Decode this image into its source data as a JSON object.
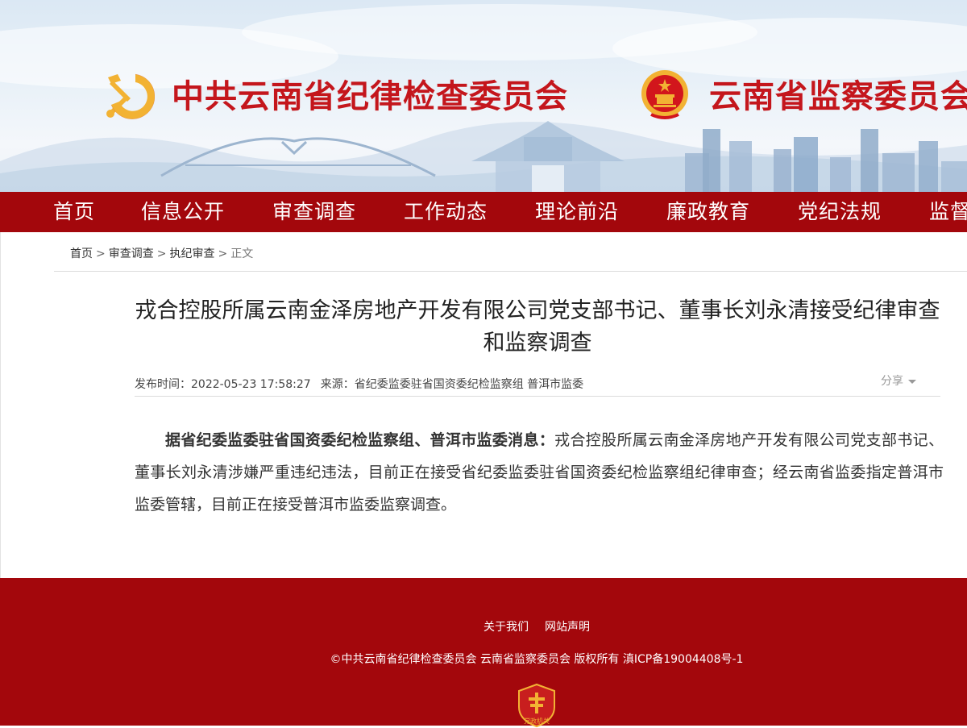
{
  "header": {
    "title_cpc": "中共云南省纪律检查委员会",
    "title_supervision": "云南省监察委员会"
  },
  "nav": {
    "items": [
      {
        "label": "首页"
      },
      {
        "label": "信息公开"
      },
      {
        "label": "审查调查"
      },
      {
        "label": "工作动态"
      },
      {
        "label": "理论前沿"
      },
      {
        "label": "廉政教育"
      },
      {
        "label": "党纪法规"
      },
      {
        "label": "监督"
      }
    ]
  },
  "breadcrumb": {
    "items": [
      "首页",
      "审查调查",
      "执纪审查"
    ],
    "current": "正文",
    "separator": ">"
  },
  "article": {
    "title": "戎合控股所属云南金泽房地产开发有限公司党支部书记、董事长刘永清接受纪律审查和监察调查",
    "publish_time": "发布时间：2022-05-23 17:58:27",
    "source": "来源：省纪委监委驻省国资委纪检监察组 普洱市监委",
    "share_label": "分享",
    "lead": "据省纪委监委驻省国资委纪检监察组、普洱市监委消息：",
    "body": "戎合控股所属云南金泽房地产开发有限公司党支部书记、董事长刘永清涉嫌严重违纪违法，目前正在接受省纪委监委驻省国资委纪检监察组纪律审查；经云南省监委指定普洱市监委管辖，目前正在接受普洱市监委监察调查。"
  },
  "footer": {
    "links": [
      "关于我们",
      "网站声明"
    ],
    "copyright": "©中共云南省纪律检查委员会 云南省监察委员会 版权所有 滇ICP备19004408号-1",
    "badge_text": "党政机关"
  },
  "colors": {
    "brand_red": "#a3070c",
    "title_red": "#c4161c",
    "emblem_gold": "#f2b233"
  }
}
